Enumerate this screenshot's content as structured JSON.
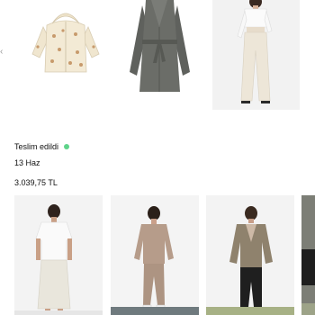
{
  "order": {
    "status_label": "Teslim edildi",
    "status_color": "#5fd38a",
    "date": "13 Haz",
    "total": "3.039,75 TL"
  },
  "top_products": [
    {
      "icon": "kids-hooded-jacket-image"
    },
    {
      "icon": "grey-belted-coat-image"
    },
    {
      "icon": "white-top-and-trousers-image"
    }
  ],
  "bottom_products": [
    {
      "icon": "white-tshirt-and-skirt-image"
    },
    {
      "icon": "beige-sweat-set-image"
    },
    {
      "icon": "khaki-knit-cardigan-image"
    },
    {
      "icon": "partial-product-image"
    }
  ]
}
